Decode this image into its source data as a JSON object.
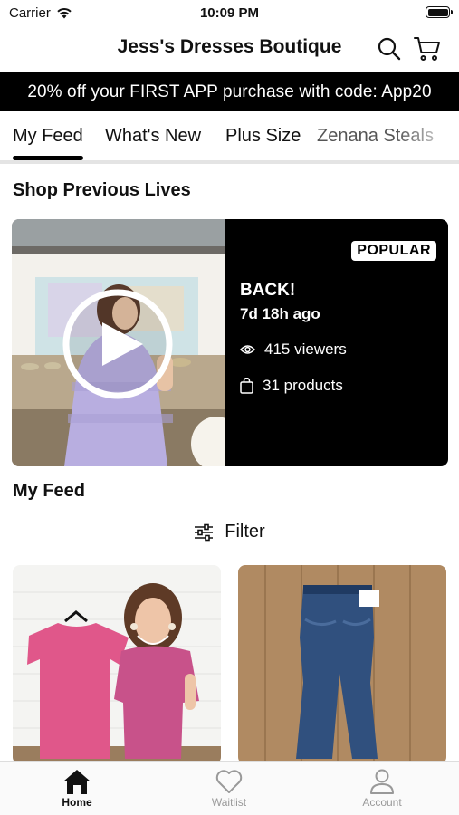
{
  "status_bar": {
    "carrier": "Carrier",
    "time": "10:09 PM"
  },
  "header": {
    "title": "Jess's Dresses Boutique",
    "search_icon": "search-icon",
    "cart_icon": "cart-icon"
  },
  "promo": {
    "text": "20% off your FIRST APP purchase with code: App20"
  },
  "tabs": [
    {
      "label": "My Feed",
      "active": true
    },
    {
      "label": "What's New"
    },
    {
      "label": "Plus Size"
    },
    {
      "label": "Zenana Steals"
    }
  ],
  "previous_lives": {
    "title": "Shop Previous Lives",
    "card": {
      "badge": "POPULAR",
      "title": "BACK!",
      "ago": "7d 18h ago",
      "viewers": "415 viewers",
      "products": "31 products"
    }
  },
  "feed": {
    "title": "My Feed",
    "filter_label": "Filter"
  },
  "bottom_nav": [
    {
      "label": "Home",
      "icon": "home-icon",
      "active": true
    },
    {
      "label": "Waitlist",
      "icon": "heart-icon"
    },
    {
      "label": "Account",
      "icon": "account-icon"
    }
  ],
  "colors": {
    "black": "#000000",
    "white": "#FFFFFF",
    "inactive": "#999999",
    "tab_border": "#E4E4E4"
  }
}
